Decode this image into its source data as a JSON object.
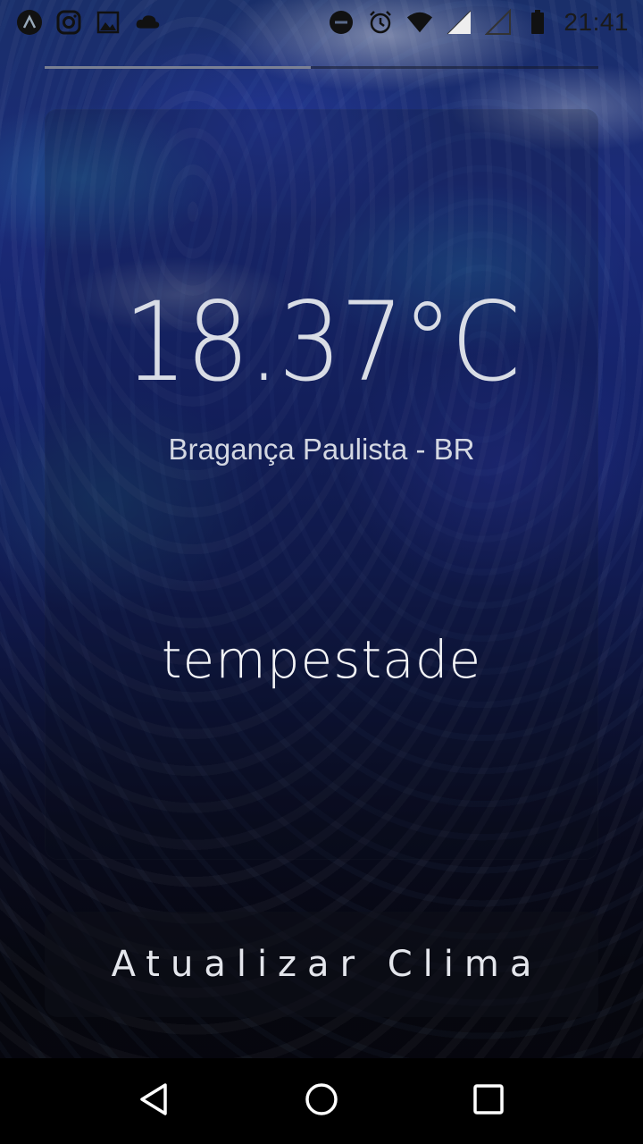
{
  "status_bar": {
    "time": "21:41",
    "left_icons": [
      "app-a-icon",
      "instagram-icon",
      "gallery-icon",
      "cloud-icon"
    ],
    "right_icons": [
      "do-not-disturb-icon",
      "alarm-icon",
      "wifi-icon",
      "signal-icon",
      "signal-empty-icon",
      "battery-icon"
    ]
  },
  "progress": {
    "fraction": 0.48
  },
  "weather": {
    "temperature": "18.37°C",
    "location": "Bragança Paulista - BR",
    "condition": "tempestade"
  },
  "actions": {
    "update_label": "Atualizar Clima"
  },
  "nav": {
    "icons": [
      "back-icon",
      "home-icon",
      "recents-icon"
    ]
  }
}
